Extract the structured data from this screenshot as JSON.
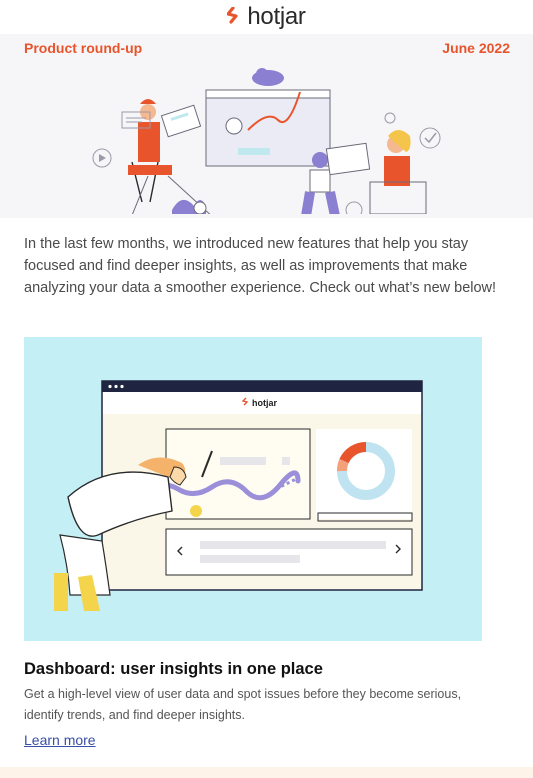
{
  "header": {
    "logo_text": "hotjar",
    "logo_icon": "hotjar-flame-icon",
    "brand_color": "#e8542b"
  },
  "hero": {
    "label_left": "Product round-up",
    "label_right": "June 2022",
    "illustration_icon": "team-collaboration-illustration"
  },
  "intro": {
    "text": "In the last few months, we introduced new features that help you stay focused and find deeper insights, as well as improvements that make analyzing your data a smoother experience. Check out what’s new below!"
  },
  "feature": {
    "illustration_icon": "dashboard-illustration",
    "illustration_logo_text": "hotjar",
    "title": "Dashboard: user insights in one place",
    "description": "Get a high-level view of user data and spot issues before they become serious, identify trends, and find deeper insights.",
    "link_label": "Learn more",
    "background_color": "#c4eff4"
  }
}
